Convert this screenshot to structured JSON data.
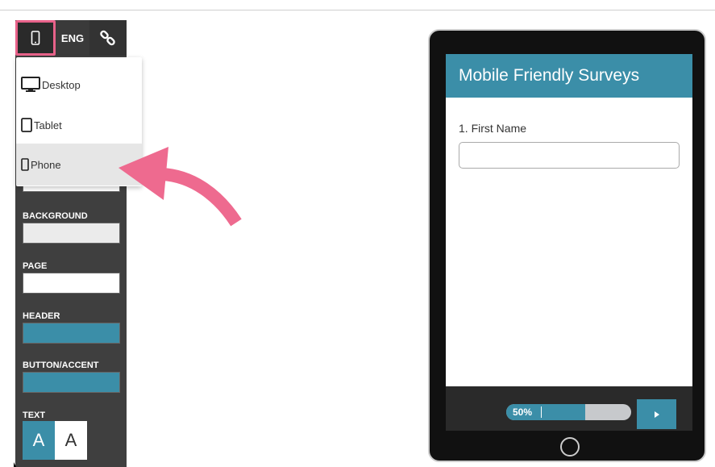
{
  "toolbar": {
    "device_icon": "phone-icon",
    "language_label": "ENG",
    "link_icon": "link-icon"
  },
  "device_menu": {
    "items": [
      {
        "label": "Desktop",
        "icon": "desktop-icon"
      },
      {
        "label": "Tablet",
        "icon": "tablet-icon"
      },
      {
        "label": "Phone",
        "icon": "phone-icon",
        "selected": true
      }
    ]
  },
  "style_panel": {
    "background_label": "BACKGROUND",
    "page_label": "PAGE",
    "header_label": "HEADER",
    "accent_label": "BUTTON/ACCENT",
    "text_label": "TEXT",
    "text_option_light": "A",
    "text_option_dark": "A",
    "colors": {
      "background": "#ebebeb",
      "page": "#ffffff",
      "header": "#3b8ea8",
      "accent": "#3b8ea8"
    }
  },
  "preview": {
    "survey_title": "Mobile Friendly Surveys",
    "question_label": "1. First Name",
    "progress_text": "50%",
    "progress_value": 0.63,
    "next_icon": "play-icon"
  },
  "accent_color": "#e8628a"
}
